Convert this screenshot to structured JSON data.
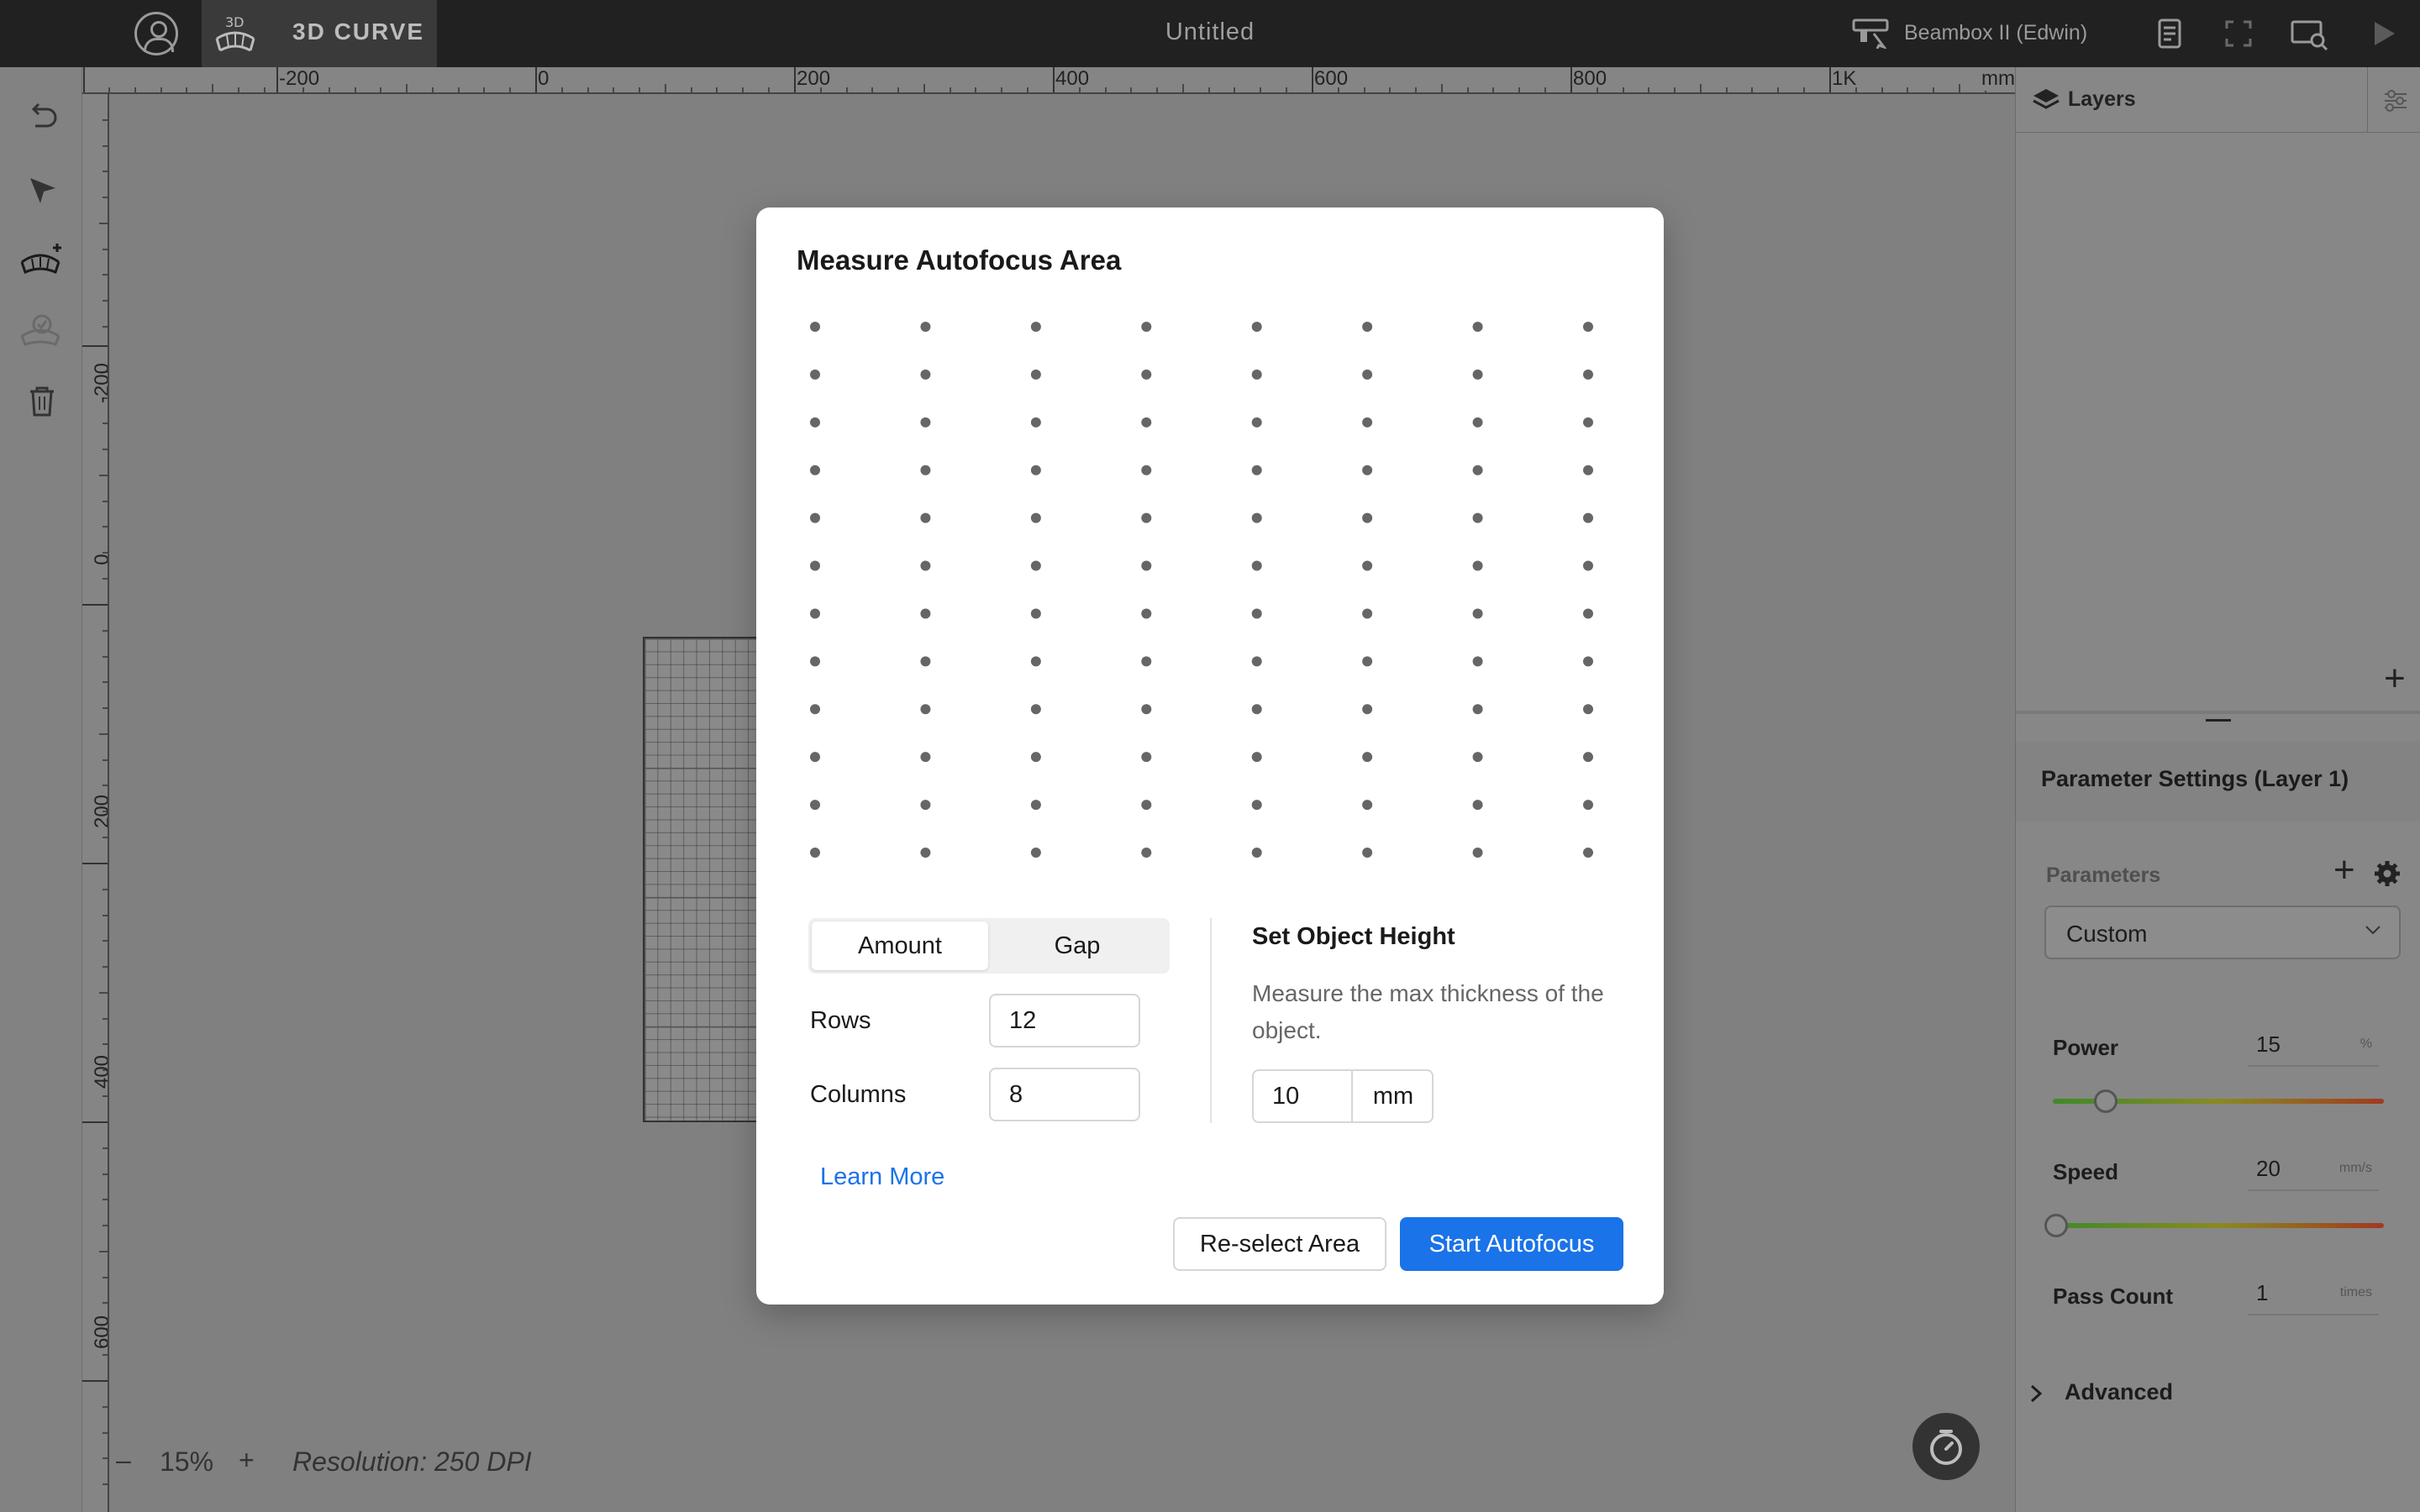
{
  "topbar": {
    "mode_label": "3D CURVE",
    "doc_title": "Untitled",
    "machine_name": "Beambox II (Edwin)"
  },
  "rulers": {
    "top_labels": [
      "-200",
      "0",
      "200",
      "400",
      "600",
      "800",
      "1K"
    ],
    "unit": "mm",
    "left_labels": [
      "-200",
      "0",
      "200",
      "400",
      "600"
    ]
  },
  "canvas": {
    "zoom_minus": "–",
    "zoom": "15%",
    "zoom_plus": "+",
    "resolution": "Resolution: 250 DPI"
  },
  "layers": {
    "title": "Layers"
  },
  "params": {
    "title": "Parameter Settings (Layer 1)",
    "section_label": "Parameters",
    "preset": "Custom",
    "power": {
      "label": "Power",
      "value": "15",
      "unit": "%",
      "level": 0.15
    },
    "speed": {
      "label": "Speed",
      "value": "20",
      "unit": "mm/s",
      "level": 0.0
    },
    "pass": {
      "label": "Pass Count",
      "value": "1",
      "unit": "times"
    },
    "advanced": "Advanced"
  },
  "modal": {
    "title": "Measure Autofocus Area",
    "grid": {
      "rows": 12,
      "columns": 8
    },
    "tab_amount": "Amount",
    "tab_gap": "Gap",
    "rows_label": "Rows",
    "rows_value": "12",
    "columns_label": "Columns",
    "columns_value": "8",
    "height_title": "Set Object Height",
    "height_desc": "Measure the max thickness of the object.",
    "height_value": "10",
    "height_unit": "mm",
    "learn_more": "Learn More",
    "reselect": "Re-select Area",
    "start": "Start Autofocus"
  },
  "colors": {
    "accent": "#1a73e8",
    "topbar": "#212121"
  }
}
